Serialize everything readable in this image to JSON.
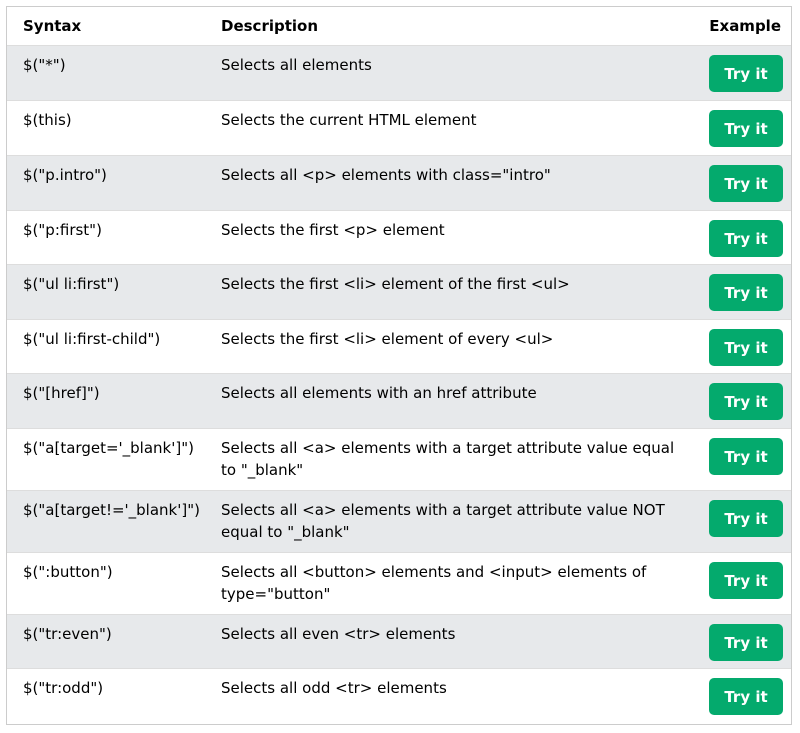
{
  "header": {
    "syntax": "Syntax",
    "description": "Description",
    "example": "Example"
  },
  "rows": [
    {
      "syntax": "$(\"*\")",
      "description": "Selects all elements",
      "button": "Try it"
    },
    {
      "syntax": "$(this)",
      "description": "Selects the current HTML element",
      "button": "Try it"
    },
    {
      "syntax": "$(\"p.intro\")",
      "description": "Selects all <p> elements with class=\"intro\"",
      "button": "Try it"
    },
    {
      "syntax": "$(\"p:first\")",
      "description": "Selects the first <p> element",
      "button": "Try it"
    },
    {
      "syntax": "$(\"ul li:first\")",
      "description": "Selects the first <li> element of the first <ul>",
      "button": "Try it"
    },
    {
      "syntax": "$(\"ul li:first-child\")",
      "description": "Selects the first <li> element of every <ul>",
      "button": "Try it"
    },
    {
      "syntax": "$(\"[href]\")",
      "description": "Selects all elements with an href attribute",
      "button": "Try it"
    },
    {
      "syntax": "$(\"a[target='_blank']\")",
      "description": "Selects all <a> elements with a target attribute value equal to \"_blank\"",
      "button": "Try it"
    },
    {
      "syntax": "$(\"a[target!='_blank']\")",
      "description": "Selects all <a> elements with a target attribute value NOT equal to \"_blank\"",
      "button": "Try it"
    },
    {
      "syntax": "$(\":button\")",
      "description": "Selects all <button> elements and <input> elements of type=\"button\"",
      "button": "Try it"
    },
    {
      "syntax": "$(\"tr:even\")",
      "description": "Selects all even <tr> elements",
      "button": "Try it"
    },
    {
      "syntax": "$(\"tr:odd\")",
      "description": "Selects all odd <tr> elements",
      "button": "Try it"
    }
  ],
  "colors": {
    "button_bg": "#04aa6d",
    "row_shade": "#e7e9eb"
  }
}
